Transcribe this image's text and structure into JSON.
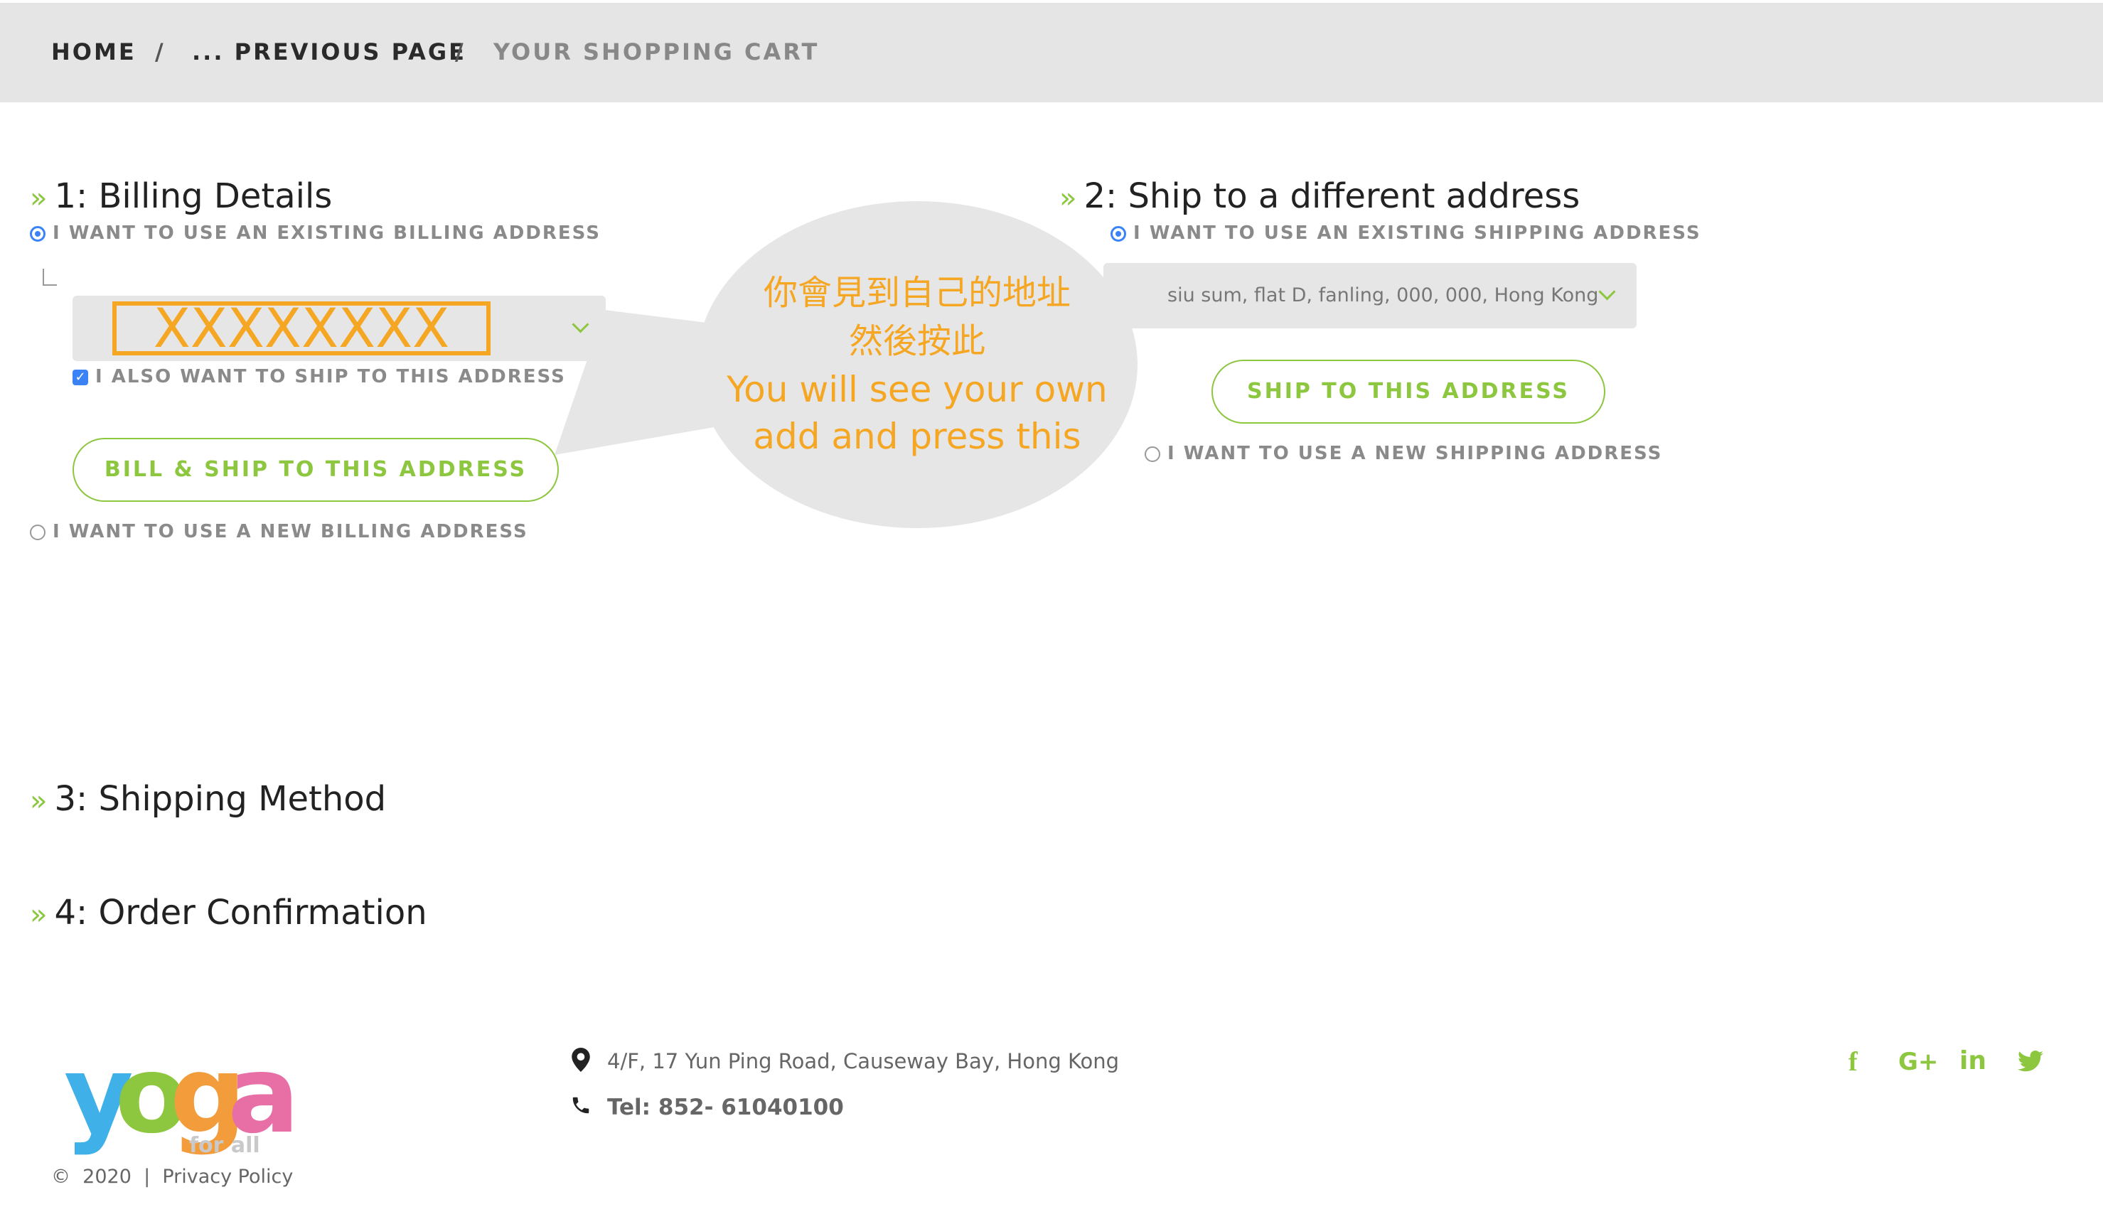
{
  "breadcrumb": {
    "home": "HOME",
    "previous": "... PREVIOUS PAGE",
    "current": "YOUR SHOPPING CART",
    "separator": "/"
  },
  "billing": {
    "heading": "1: Billing Details",
    "existing_option": "I WANT TO USE AN EXISTING BILLING ADDRESS",
    "selected_address": "XXXXXXXX",
    "also_ship_label": "I ALSO WANT TO SHIP TO THIS ADDRESS",
    "also_ship_checked": true,
    "button_label": "BILL & SHIP TO THIS ADDRESS",
    "new_option": "I WANT TO USE A NEW BILLING ADDRESS"
  },
  "shipping": {
    "heading": "2: Ship to a different address",
    "existing_option": "I WANT TO USE AN EXISTING SHIPPING ADDRESS",
    "selected_address": "siu sum, flat D, fanling, 000, 000, Hong Kong",
    "button_label": "SHIP TO THIS ADDRESS",
    "new_option": "I WANT TO USE A NEW SHIPPING ADDRESS"
  },
  "callout": {
    "line1": "你會見到自己的地址",
    "line2": "然後按此",
    "line3": "You will see your own",
    "line4": "add and press this"
  },
  "sections": {
    "shipping_method": "3: Shipping Method",
    "order_confirmation": "4: Order Confirmation",
    "marker": "»"
  },
  "footer": {
    "logo_text": "yoga",
    "logo_tagline": "for all",
    "address": "4/F, 17 Yun Ping Road, Causeway Bay, Hong Kong",
    "phone": "Tel: 852- 61040100",
    "copyright_symbol": "©",
    "year": "2020",
    "divider": "|",
    "privacy": "Privacy Policy",
    "social": {
      "facebook": "f",
      "google_plus": "G+",
      "linkedin": "in"
    }
  },
  "colors": {
    "accent_green": "#8dc63f",
    "annotation_orange": "#f5a623",
    "radio_blue": "#3b82f6",
    "breadcrumb_bg": "#e5e5e5"
  }
}
